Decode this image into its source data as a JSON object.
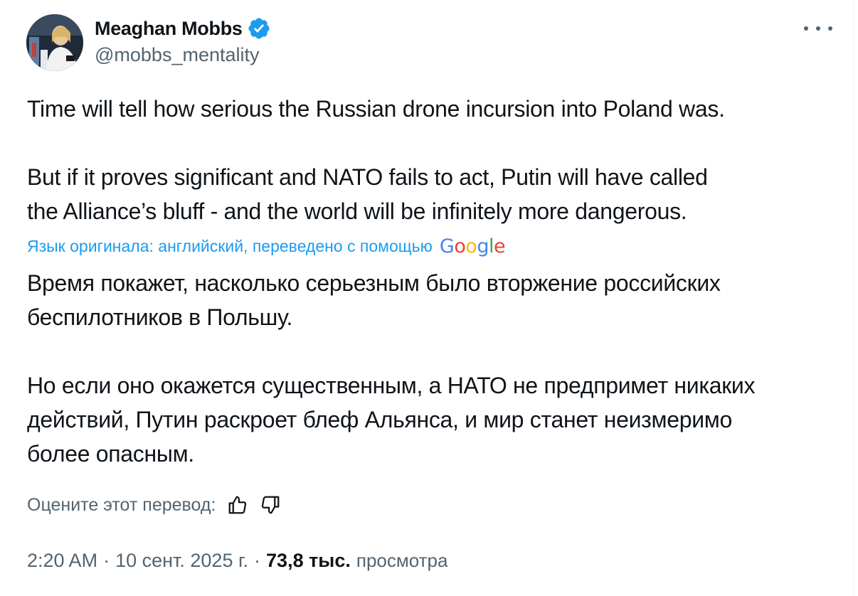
{
  "author": {
    "display_name": "Meaghan Mobbs",
    "handle": "@mobbs_mentality",
    "verified_icon": "verified-badge-icon",
    "avatar_icon": "profile-photo"
  },
  "more_icon": "more-options-icon",
  "tweet": {
    "original_lines": [
      "Time will tell how serious the Russian drone incursion into Poland was.",
      "But if it proves significant and NATO fails to act, Putin will have called",
      "the Alliance’s bluff - and the world will be infinitely more dangerous."
    ],
    "translation_note": "Язык оригинала: английский, переведено с помощью",
    "translation_provider": [
      "G",
      "o",
      "o",
      "g",
      "l",
      "e"
    ],
    "translated_lines": [
      "Время покажет, насколько серьезным было вторжение российских",
      "беспилотников в Польшу.",
      "Но если оно окажется существенным, а НАТО не предпримет никаких",
      "действий, Путин раскроет блеф Альянса, и мир станет неизмеримо",
      "более опасным."
    ]
  },
  "rating": {
    "label": "Оцените этот перевод:",
    "thumbs_up_icon": "thumbs-up-icon",
    "thumbs_down_icon": "thumbs-down-icon"
  },
  "meta": {
    "time": "2:20 AM",
    "separator": "·",
    "date": "10 сент. 2025 г.",
    "views_count": "73,8 тыс.",
    "views_label": "просмотра"
  },
  "colors": {
    "text": "#0f1419",
    "secondary": "#536471",
    "link": "#1d9bf0",
    "verified": "#1d9bf0"
  }
}
